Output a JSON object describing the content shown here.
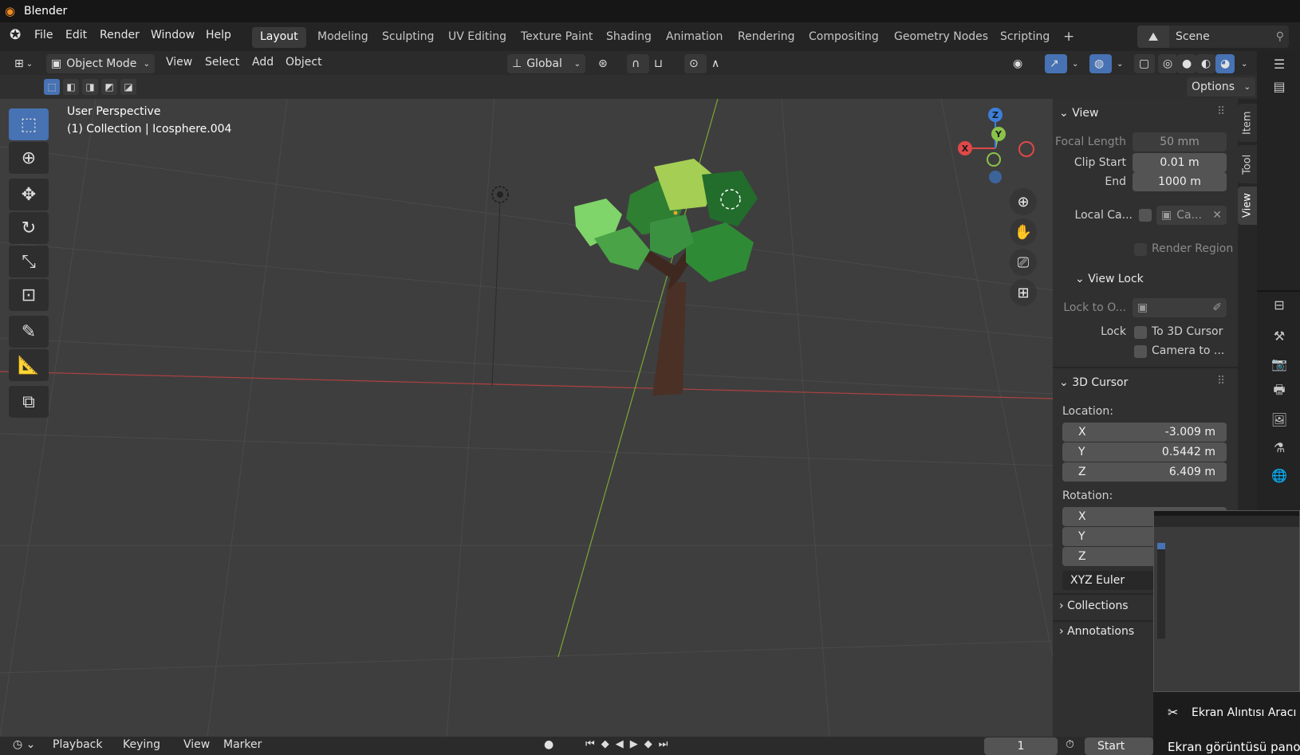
{
  "titlebar": {
    "title": "Blender"
  },
  "menu": [
    "File",
    "Edit",
    "Render",
    "Window",
    "Help"
  ],
  "workspaces": [
    {
      "label": "Layout",
      "active": true
    },
    {
      "label": "Modeling"
    },
    {
      "label": "Sculpting"
    },
    {
      "label": "UV Editing"
    },
    {
      "label": "Texture Paint"
    },
    {
      "label": "Shading"
    },
    {
      "label": "Animation"
    },
    {
      "label": "Rendering"
    },
    {
      "label": "Compositing"
    },
    {
      "label": "Geometry Nodes"
    },
    {
      "label": "Scripting"
    }
  ],
  "add_workspace": "+",
  "scene": {
    "name": "Scene"
  },
  "header": {
    "mode": "Object Mode",
    "menus": [
      "View",
      "Select",
      "Add",
      "Object"
    ],
    "orientation": "Global",
    "options_label": "Options"
  },
  "viewport": {
    "view_name": "User Perspective",
    "collection_info": "(1) Collection | Icosphere.004",
    "gizmo": {
      "x": "X",
      "y": "Y",
      "z": "Z"
    }
  },
  "npanel": {
    "view_section": "View",
    "focal_length_label": "Focal Length",
    "focal_length": "50 mm",
    "clip_start_label": "Clip Start",
    "clip_start": "0.01 m",
    "end_label": "End",
    "clip_end": "1000 m",
    "local_camera_label": "Local Ca...",
    "local_camera_value": "Ca...",
    "render_region_label": "Render Region",
    "view_lock_section": "View Lock",
    "lock_to_object_label": "Lock to O...",
    "lock_label": "Lock",
    "to_3d_cursor": "To 3D Cursor",
    "camera_to": "Camera to ...",
    "cursor_section": "3D Cursor",
    "location_label": "Location:",
    "loc_x_label": "X",
    "loc_x": "-3.009 m",
    "loc_y_label": "Y",
    "loc_y": "0.5442 m",
    "loc_z_label": "Z",
    "loc_z": "6.409 m",
    "rotation_label": "Rotation:",
    "rot_x_label": "X",
    "rot_y_label": "Y",
    "rot_z_label": "Z",
    "rotation_mode": "XYZ Euler",
    "collections_section": "Collections",
    "annotations_section": "Annotations"
  },
  "sidebar_tabs": [
    "Item",
    "Tool",
    "View"
  ],
  "timeline": {
    "menus": [
      "Playback",
      "Keying",
      "View",
      "Marker"
    ],
    "frame": "1",
    "start_label": "Start"
  },
  "toast": {
    "app": "Ekran Alıntısı Aracı",
    "message": "Ekran görüntüsü pano"
  },
  "colors": {
    "accent": "#4772b3",
    "x_axis": "#e04848",
    "y_axis": "#8bc34a",
    "z_axis": "#3d7fd8",
    "foliage": "#3f8f3a",
    "trunk": "#4a3025"
  }
}
